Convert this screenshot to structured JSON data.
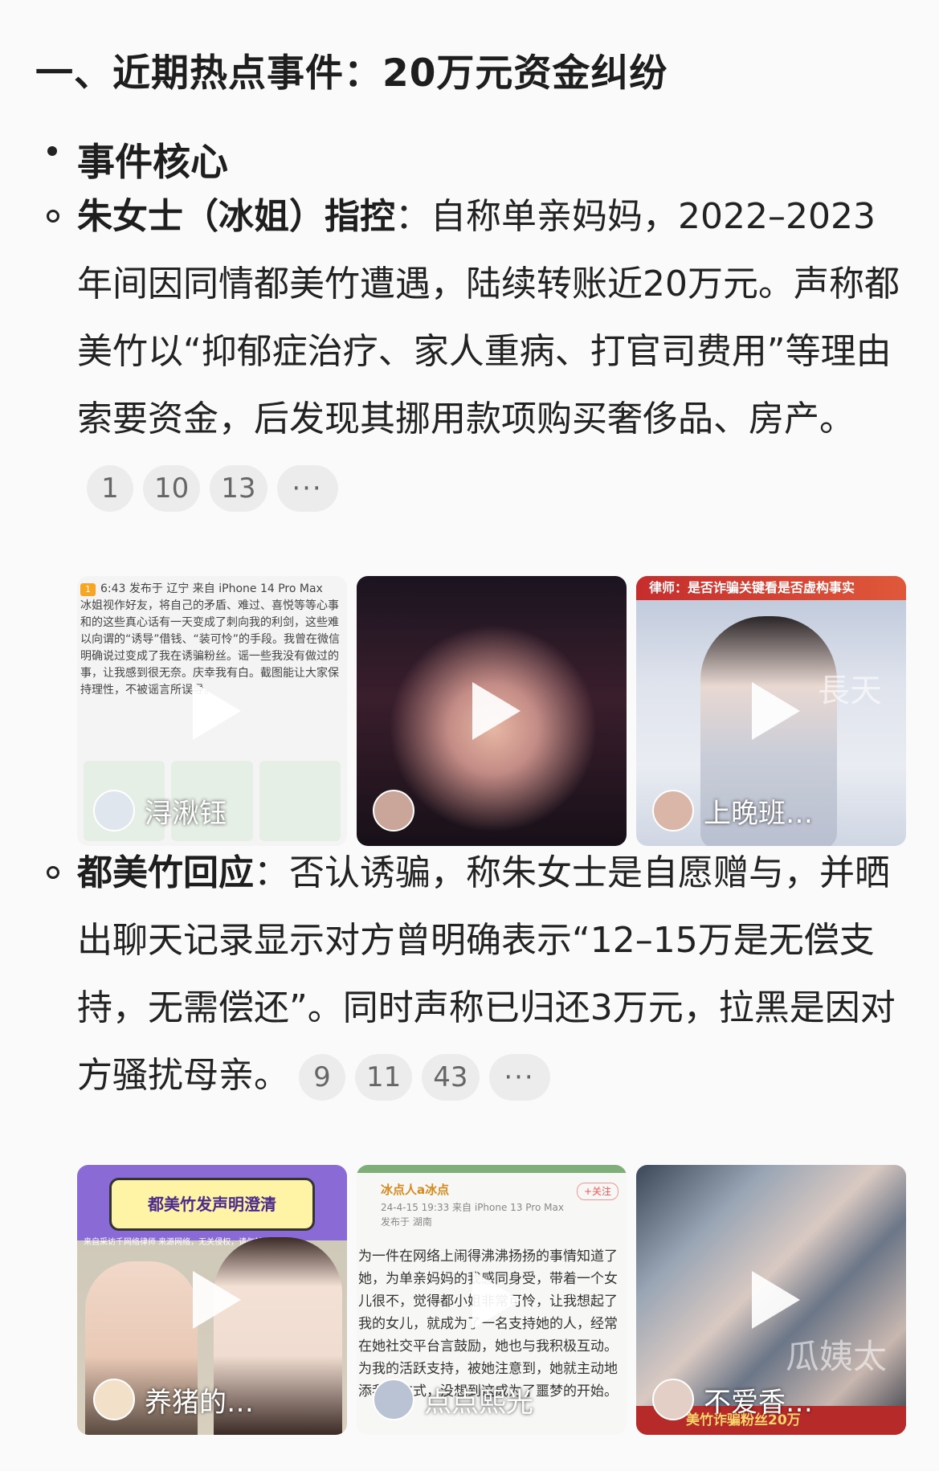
{
  "section_title": "一、近期热点事件：20万元资金纠纷",
  "subheading": "事件核心",
  "item1": {
    "label": "朱女士（冰姐）指控",
    "colon": "：",
    "text": "自称单亲妈妈，2022–2023年间因同情都美竹遭遇，陆续转账近20万元。声称都美竹以“抑郁症治疗、家人重病、打官司费用”等理由索要资金，后发现其挪用款项购买奢侈品、房产。",
    "citations": [
      "1",
      "10",
      "13"
    ],
    "more": "···"
  },
  "videos1": [
    {
      "author": "浔湫钰",
      "badge": "1",
      "meta": "6:43 发布于 辽宁 来自 iPhone 14 Pro Max",
      "text": "冰姐视作好友，将自己的矛盾、难过、喜悦等等心事和的这些真心话有一天变成了刺向我的利剑，这些难以向谓的“诱导”借钱、“装可怜”的手段。我曾在微信明确说过变成了我在诱骗粉丝。谣一些我没有做过的事，让我感到很无奈。庆幸我有白。截图能让大家保持理性，不被谣言所误导。"
    },
    {
      "author": ""
    },
    {
      "author": "上晚班…",
      "banner": "律师：是否诈骗关键看是否虚构事实",
      "watermark": "長天"
    }
  ],
  "item2": {
    "label": "都美竹回应",
    "colon": "：",
    "text": "否认诱骗，称朱女士是自愿赠与，并晒出聊天记录显示对方曾明确表示“12–15万是无偿支持，无需偿还”。同时声称已归还3万元，拉黑是因对方骚扰母亲。",
    "citations": [
      "9",
      "11",
      "43"
    ],
    "more": "···"
  },
  "videos2": [
    {
      "author": "养猪的…",
      "card": "都美竹发声明澄清",
      "strip": "来自采访千网络律师 来源网络，无关侵权，请勿转发"
    },
    {
      "author": "点点熙光",
      "post_user": "冰点人a冰点",
      "post_meta_1": "24-4-15 19:33 来自 iPhone 13 Pro Max",
      "post_meta_2": "发布于 湖南",
      "follow": "+关注",
      "post_text": "为一件在网络上闹得沸沸扬扬的事情知道了她，为单亲妈妈的我感同身受，带着一个女儿很不，觉得都小姐非常可怜，让我想起了我的女儿，就成为了一名支持她的人，经常在她社交平台言鼓励，她也与我积极互动。为我的活跃支持，被她注意到，她就主动地添我的方式，没想到这成为了噩梦的开始。"
    },
    {
      "author": "不爱香…",
      "frame_text": "美竹诈骗粉丝20万",
      "watermark": "瓜姨太"
    }
  ],
  "colors": {
    "background": "#fafafa",
    "text": "#222222",
    "citation_bg": "#ececec",
    "citation_text": "#666666"
  }
}
